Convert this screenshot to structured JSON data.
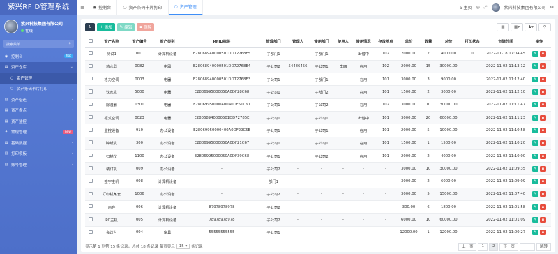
{
  "brand": "紫兴RFID管理系统",
  "user": {
    "name": "紫兴科技集团有限公司",
    "status": "在线"
  },
  "search_placeholder": "搜索菜单",
  "menu": [
    {
      "icon": "dashboard-icon",
      "glyph": "◉",
      "label": "控制台",
      "badge": "hot",
      "chevron": "",
      "state": ""
    },
    {
      "icon": "warehouse-icon",
      "glyph": "▤",
      "label": "资产仓库",
      "badge": "",
      "chevron": "⌄",
      "state": "active-parent"
    },
    {
      "icon": "circle-icon",
      "glyph": "○",
      "label": "资产管理",
      "badge": "",
      "chevron": "",
      "state": "active sub"
    },
    {
      "icon": "circle-icon",
      "glyph": "○",
      "label": "资产条码卡片打印",
      "badge": "",
      "chevron": "",
      "state": "sub"
    },
    {
      "icon": "borrow-icon",
      "glyph": "▤",
      "label": "资产借还",
      "badge": "",
      "chevron": "‹",
      "state": ""
    },
    {
      "icon": "inventory-icon",
      "glyph": "▤",
      "label": "资产盘点",
      "badge": "",
      "chevron": "‹",
      "state": ""
    },
    {
      "icon": "monitor-icon",
      "glyph": "▤",
      "label": "资产监控",
      "badge": "",
      "chevron": "‹",
      "state": ""
    },
    {
      "icon": "settings-icon",
      "glyph": "✦",
      "label": "常规管理",
      "badge": "new",
      "chevron": "",
      "state": ""
    },
    {
      "icon": "database-icon",
      "glyph": "▤",
      "label": "基础数据",
      "badge": "",
      "chevron": "‹",
      "state": ""
    },
    {
      "icon": "print-template-icon",
      "glyph": "▤",
      "label": "打印模板",
      "badge": "",
      "chevron": "‹",
      "state": ""
    },
    {
      "icon": "account-icon",
      "glyph": "▤",
      "label": "账号管理",
      "badge": "",
      "chevron": "‹",
      "state": ""
    }
  ],
  "tabs": [
    {
      "icon": "dashboard-icon",
      "glyph": "◉",
      "label": "控制台",
      "active": false
    },
    {
      "icon": "barcode-icon",
      "glyph": "○",
      "label": "资产条码卡片打印",
      "active": false
    },
    {
      "icon": "circle-icon",
      "glyph": "○",
      "label": "资产管理",
      "active": true
    }
  ],
  "topbar_right": {
    "home": "主页",
    "company": "紫兴科技集团有限公司"
  },
  "toolbar": {
    "add": "添加",
    "edit": "编辑",
    "delete": "删除"
  },
  "columns": [
    "资产名称",
    "资产编号",
    "资产类别",
    "RFID标签",
    "管理部门",
    "管理人",
    "使用部门",
    "使用人",
    "使用情况",
    "存放地点",
    "单价",
    "数量",
    "总价",
    "打印状态",
    "创建时间",
    "操作"
  ],
  "rows": [
    [
      "测试1",
      "001",
      "计算机设备",
      "E28068940000501DD72768E5",
      "子部门1",
      "",
      "子部门1",
      "",
      "出借中",
      "102",
      "2000.00",
      "2",
      "4000.00",
      "0",
      "2022-11-18 17:04:45"
    ],
    [
      "热水器",
      "0082",
      "电器",
      "E28068940000501DD72768E4",
      "子公司2",
      "54486456",
      "子公司1",
      "李四",
      "在用",
      "102",
      "2000.00",
      "15",
      "30000.00",
      "",
      "2022-11-02 11:13:12"
    ],
    [
      "格力空调",
      "0003",
      "电器",
      "E28068940000501DD72768E3",
      "子公司1",
      "",
      "子部门1",
      "",
      "在用",
      "101",
      "3000.00",
      "3",
      "9000.00",
      "",
      "2022-11-02 11:12:40"
    ],
    [
      "饮水机",
      "5000",
      "电器",
      "E2806995000050A0DF28C68",
      "子公司1",
      "",
      "子部门2",
      "",
      "在用",
      "101",
      "1500.00",
      "2",
      "3000.00",
      "",
      "2022-11-02 11:12:10"
    ],
    [
      "除湿器",
      "1300",
      "电器",
      "E28069950000400A0DF51C61",
      "子公司1",
      "",
      "子公司2",
      "",
      "在用",
      "102",
      "3000.00",
      "10",
      "30000.00",
      "",
      "2022-11-02 11:11:47"
    ],
    [
      "柜式空调",
      "0023",
      "电器",
      "E28068940000501DD72785E",
      "子公司1",
      "",
      "子公司1",
      "",
      "出借中",
      "101",
      "3000.00",
      "20",
      "60000.00",
      "",
      "2022-11-02 11:11:23"
    ],
    [
      "监控设备",
      "910",
      "办公设备",
      "E28069950000400A0DF29C5E",
      "子公司1",
      "",
      "子公司1",
      "",
      "在用",
      "101",
      "2000.00",
      "5",
      "10000.00",
      "",
      "2022-11-02 11:10:58"
    ],
    [
      "碎纸机",
      "300",
      "办公设备",
      "E2806995000050A0DF21C67",
      "子公司1",
      "",
      "子公司1",
      "",
      "在用",
      "101",
      "1500.00",
      "1",
      "1500.00",
      "",
      "2022-11-02 11:10:20"
    ],
    [
      "扫描仪",
      "1100",
      "办公设备",
      "E2806995000050A0DF39C68",
      "子公司1",
      "",
      "子公司2",
      "",
      "在用",
      "101",
      "2000.00",
      "2",
      "4000.00",
      "",
      "2022-11-02 11:10:00"
    ],
    [
      "装订机",
      "009",
      "办公设备",
      "-",
      "子公司2",
      "-",
      "-",
      "-",
      "-",
      "-",
      "3000.00",
      "10",
      "30000.00",
      "",
      "2022-11-02 11:09:35"
    ],
    [
      "签字主机",
      "008",
      "计算机设备",
      "-",
      "部门1",
      "-",
      "-",
      "-",
      "-",
      "-",
      "3000.00",
      "2",
      "6000.00",
      "",
      "2022-11-02 11:09:09"
    ],
    [
      "打印机某套",
      "1006",
      "办公设备",
      "-",
      "子公司2",
      "-",
      "-",
      "-",
      "-",
      "-",
      "3000.00",
      "5",
      "15000.00",
      "",
      "2022-11-02 11:07:40"
    ],
    [
      "内存",
      "006",
      "计算机设备",
      "87978978978",
      "子公司2",
      "-",
      "-",
      "-",
      "-",
      "-",
      "300.00",
      "6",
      "1800.00",
      "",
      "2022-11-02 11:01:58"
    ],
    [
      "PC主机",
      "005",
      "计算机设备",
      "78978978978",
      "子公司2",
      "-",
      "-",
      "-",
      "-",
      "-",
      "6000.00",
      "10",
      "60000.00",
      "",
      "2022-11-02 11:01:09"
    ],
    [
      "会议台",
      "004",
      "家具",
      "55555555555",
      "子公司1",
      "-",
      "-",
      "-",
      "-",
      "-",
      "12000.00",
      "1",
      "12000.00",
      "",
      "2022-11-02 11:00:27"
    ]
  ],
  "footer": {
    "summary_pre": "显示第 1 到第 15 条记录，总共 18 条记录 每页显示",
    "page_size": "15",
    "summary_post": "条记录",
    "prev": "上一页",
    "pages": [
      "1",
      "2"
    ],
    "current": "2",
    "next": "下一页",
    "jump": "跳转"
  },
  "colors": {
    "sidebar": "#5a7fd8",
    "accent": "#3e8ef7",
    "add": "#18bc9c",
    "delete": "#e74c3c",
    "header": "#2c3e50"
  }
}
